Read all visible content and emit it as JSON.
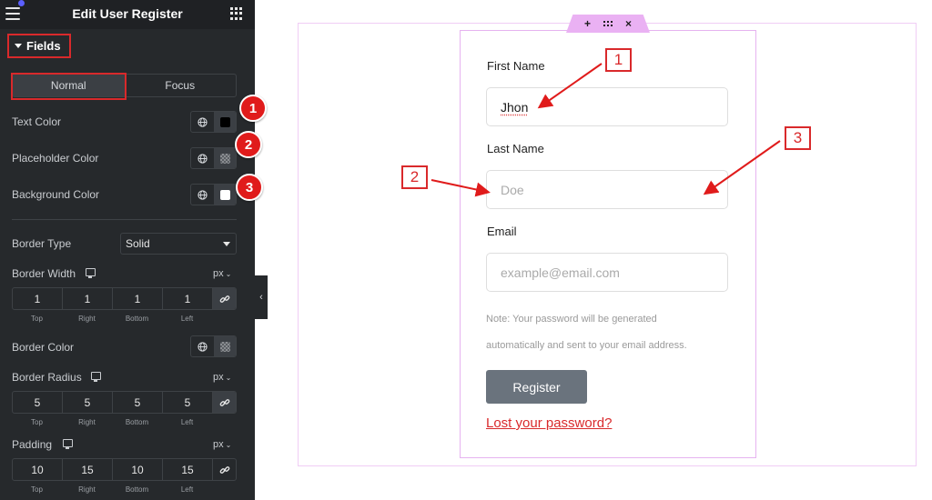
{
  "panel": {
    "title": "Edit User Register",
    "section": "Fields",
    "tabs": [
      {
        "label": "Normal",
        "active": true
      },
      {
        "label": "Focus",
        "active": false
      }
    ],
    "color_rows": [
      {
        "label": "Text Color",
        "swatch": "#000000",
        "badge": "1"
      },
      {
        "label": "Placeholder Color",
        "swatch": "checker",
        "badge": "2"
      },
      {
        "label": "Background Color",
        "swatch": "#ffffff",
        "badge": "3"
      }
    ],
    "border_type": {
      "label": "Border Type",
      "value": "Solid"
    },
    "border_width": {
      "label": "Border Width",
      "unit": "px",
      "values": [
        "1",
        "1",
        "1",
        "1"
      ]
    },
    "border_color": {
      "label": "Border Color"
    },
    "border_radius": {
      "label": "Border Radius",
      "unit": "px",
      "values": [
        "5",
        "5",
        "5",
        "5"
      ]
    },
    "padding": {
      "label": "Padding",
      "unit": "px",
      "values": [
        "10",
        "15",
        "10",
        "15"
      ]
    },
    "side_labels": [
      "Top",
      "Right",
      "Bottom",
      "Left"
    ]
  },
  "toolbar": {
    "add": "+",
    "close": "×"
  },
  "form": {
    "first_name": {
      "label": "First Name",
      "value": "Jhon"
    },
    "last_name": {
      "label": "Last Name",
      "placeholder": "Doe"
    },
    "email": {
      "label": "Email",
      "placeholder": "example@email.com"
    },
    "note_line1": "Note: Your password will be generated",
    "note_line2": "automatically and sent to your email address.",
    "submit": "Register",
    "lost_password": "Lost your password?"
  },
  "callouts": [
    "1",
    "2",
    "3"
  ],
  "colors": {
    "annotation_red": "#d9292b",
    "panel_bg": "#26292c",
    "button_bg": "#6a737d",
    "widget_outline": "#e6b3f0"
  }
}
